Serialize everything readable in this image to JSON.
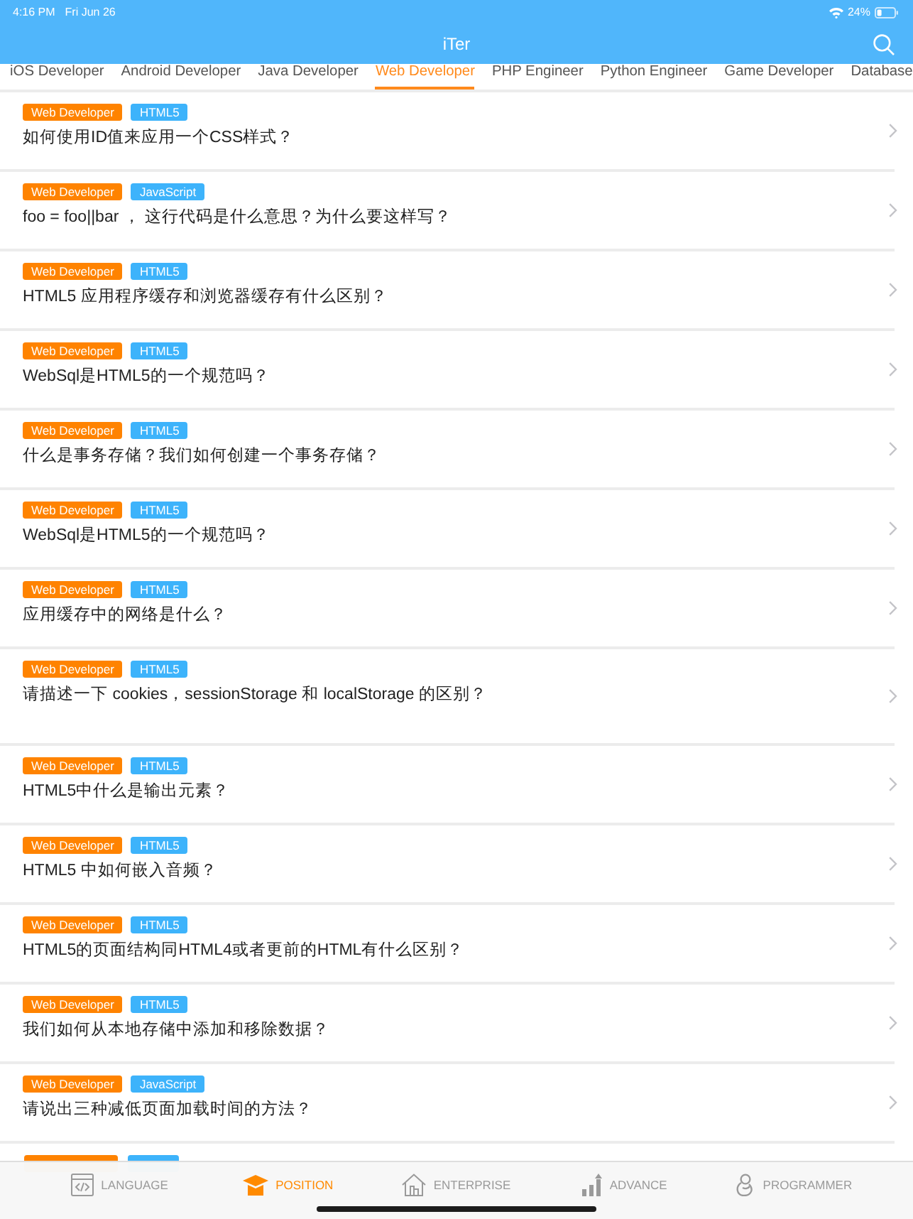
{
  "status_bar": {
    "time": "4:16 PM",
    "date": "Fri Jun 26",
    "battery": "24%"
  },
  "nav_bar": {
    "title": "iTer"
  },
  "categories": [
    {
      "label": "iOS Developer",
      "selected": false
    },
    {
      "label": "Android Developer",
      "selected": false
    },
    {
      "label": "Java Developer",
      "selected": false
    },
    {
      "label": "Web Developer",
      "selected": true
    },
    {
      "label": "PHP Engineer",
      "selected": false
    },
    {
      "label": "Python Engineer",
      "selected": false
    },
    {
      "label": "Game Developer",
      "selected": false
    },
    {
      "label": "Database",
      "selected": false
    }
  ],
  "questions": [
    {
      "kind": "standard",
      "tags": [
        {
          "label": "Web Developer",
          "kind": "category"
        },
        {
          "label": "HTML5",
          "kind": "topic"
        }
      ],
      "title": "如何使用ID值来应用一个CSS样式？"
    },
    {
      "kind": "standard",
      "tags": [
        {
          "label": "Web Developer",
          "kind": "category"
        },
        {
          "label": "JavaScript",
          "kind": "topic"
        }
      ],
      "title": "foo = foo||bar ， 这行代码是什么意思？为什么要这样写？"
    },
    {
      "kind": "standard",
      "tags": [
        {
          "label": "Web Developer",
          "kind": "category"
        },
        {
          "label": "HTML5",
          "kind": "topic"
        }
      ],
      "title": "HTML5 应用程序缓存和浏览器缓存有什么区别？"
    },
    {
      "kind": "standard",
      "tags": [
        {
          "label": "Web Developer",
          "kind": "category"
        },
        {
          "label": "HTML5",
          "kind": "topic"
        }
      ],
      "title": "WebSql是HTML5的一个规范吗？"
    },
    {
      "kind": "standard",
      "tags": [
        {
          "label": "Web Developer",
          "kind": "category"
        },
        {
          "label": "HTML5",
          "kind": "topic"
        }
      ],
      "title": "什么是事务存储？我们如何创建一个事务存储？"
    },
    {
      "kind": "standard",
      "tags": [
        {
          "label": "Web Developer",
          "kind": "category"
        },
        {
          "label": "HTML5",
          "kind": "topic"
        }
      ],
      "title": "WebSql是HTML5的一个规范吗？"
    },
    {
      "kind": "standard",
      "tags": [
        {
          "label": "Web Developer",
          "kind": "category"
        },
        {
          "label": "HTML5",
          "kind": "topic"
        }
      ],
      "title": "应用缓存中的网络是什么？"
    },
    {
      "kind": "tall",
      "tags": [
        {
          "label": "Web Developer",
          "kind": "category"
        },
        {
          "label": "HTML5",
          "kind": "topic"
        }
      ],
      "title": "请描述一下 cookies，sessionStorage 和 localStorage 的区别？"
    },
    {
      "kind": "standard",
      "tags": [
        {
          "label": "Web Developer",
          "kind": "category"
        },
        {
          "label": "HTML5",
          "kind": "topic"
        }
      ],
      "title": "HTML5中什么是输出元素？"
    },
    {
      "kind": "standard",
      "tags": [
        {
          "label": "Web Developer",
          "kind": "category"
        },
        {
          "label": "HTML5",
          "kind": "topic"
        }
      ],
      "title": "HTML5 中如何嵌入音频？"
    },
    {
      "kind": "standard",
      "tags": [
        {
          "label": "Web Developer",
          "kind": "category"
        },
        {
          "label": "HTML5",
          "kind": "topic"
        }
      ],
      "title": "HTML5的页面结构同HTML4或者更前的HTML有什么区别？"
    },
    {
      "kind": "standard",
      "tags": [
        {
          "label": "Web Developer",
          "kind": "category"
        },
        {
          "label": "HTML5",
          "kind": "topic"
        }
      ],
      "title": "我们如何从本地存储中添加和移除数据？"
    },
    {
      "kind": "standard",
      "tags": [
        {
          "label": "Web Developer",
          "kind": "category"
        },
        {
          "label": "JavaScript",
          "kind": "topic"
        }
      ],
      "title": "请说出三种减低页面加载时间的方法？"
    }
  ],
  "partial_row": {
    "tags": [
      {
        "kind": "category"
      },
      {
        "kind": "topic"
      }
    ]
  },
  "tab_bar": [
    {
      "label": "LANGUAGE",
      "selected": false
    },
    {
      "label": "POSITION",
      "selected": true
    },
    {
      "label": "ENTERPRISE",
      "selected": false
    },
    {
      "label": "ADVANCE",
      "selected": false
    },
    {
      "label": "PROGRAMMER",
      "selected": false
    }
  ]
}
